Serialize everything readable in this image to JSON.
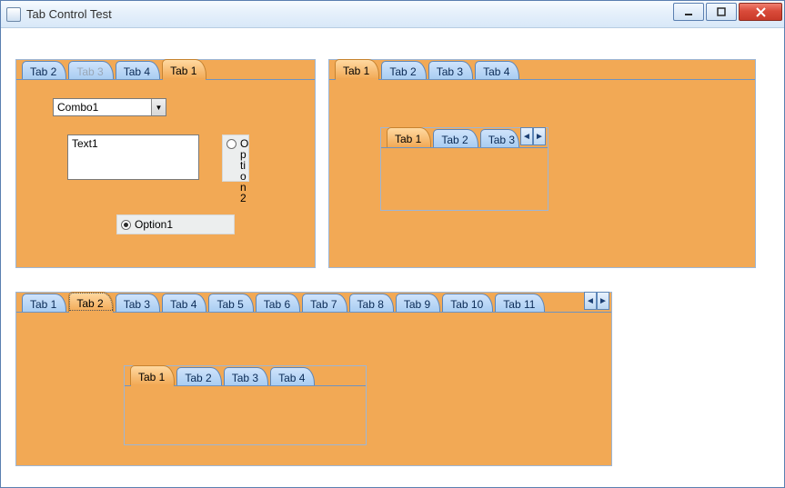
{
  "window": {
    "title": "Tab Control Test"
  },
  "panelA": {
    "tabs": [
      {
        "label": "Tab 2",
        "state": "normal"
      },
      {
        "label": "Tab 3",
        "state": "disabled"
      },
      {
        "label": "Tab 4",
        "state": "normal"
      },
      {
        "label": "Tab 1",
        "state": "active"
      }
    ],
    "combo": {
      "value": "Combo1"
    },
    "textbox": {
      "value": "Text1"
    },
    "option2": {
      "label": "Option2",
      "checked": false
    },
    "option1": {
      "label": "Option1",
      "checked": true
    }
  },
  "panelB": {
    "tabs": [
      {
        "label": "Tab 1",
        "state": "active"
      },
      {
        "label": "Tab 2",
        "state": "normal"
      },
      {
        "label": "Tab 3",
        "state": "normal"
      },
      {
        "label": "Tab 4",
        "state": "normal"
      }
    ],
    "innerTabs": [
      {
        "label": "Tab 1",
        "state": "active"
      },
      {
        "label": "Tab 2",
        "state": "normal"
      },
      {
        "label": "Tab 3",
        "state": "partial"
      }
    ]
  },
  "panelC": {
    "tabs": [
      {
        "label": "Tab 1",
        "state": "normal"
      },
      {
        "label": "Tab 2",
        "state": "active"
      },
      {
        "label": "Tab 3",
        "state": "normal"
      },
      {
        "label": "Tab 4",
        "state": "normal"
      },
      {
        "label": "Tab 5",
        "state": "normal"
      },
      {
        "label": "Tab 6",
        "state": "normal"
      },
      {
        "label": "Tab 7",
        "state": "normal"
      },
      {
        "label": "Tab 8",
        "state": "normal"
      },
      {
        "label": "Tab 9",
        "state": "normal"
      },
      {
        "label": "Tab 10",
        "state": "normal"
      },
      {
        "label": "Tab 11",
        "state": "normal"
      }
    ],
    "innerTabs": [
      {
        "label": "Tab 1",
        "state": "active"
      },
      {
        "label": "Tab 2",
        "state": "normal"
      },
      {
        "label": "Tab 3",
        "state": "normal"
      },
      {
        "label": "Tab 4",
        "state": "normal"
      }
    ]
  },
  "glyphs": {
    "left": "◄",
    "right": "►",
    "down": "▼"
  }
}
